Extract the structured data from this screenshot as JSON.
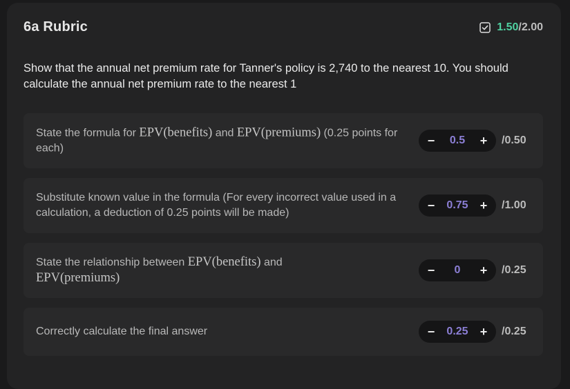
{
  "header": {
    "title": "6a Rubric",
    "score_earned": "1.50",
    "score_sep": "/",
    "score_total": "2.00",
    "icon": "checkbox-checked-icon",
    "accent_color": "#4fd1a1"
  },
  "question": "Show that the annual net premium rate for Tanner's policy is 2,740 to the nearest 10. You should calculate the annual net premium rate to the nearest 1",
  "criteria": [
    {
      "pre": "State the formula for ",
      "math1": "EPV(benefits)",
      "mid": " and ",
      "math2": "EPV(premiums)",
      "post": " (0.25 points for each)",
      "value": "0.5",
      "max": "/0.50"
    },
    {
      "text": "Substitute known value in the formula (For every incorrect value used in a calculation, a deduction of 0.25 points will be made)",
      "value": "0.75",
      "max": "/1.00"
    },
    {
      "pre": "State the relationship between ",
      "math1": "EPV(benefits)",
      "mid": " and",
      "math2": "EPV(premiums)",
      "value": "0",
      "max": "/0.25"
    },
    {
      "text": "Correctly calculate the final answer",
      "value": "0.25",
      "max": "/0.25"
    }
  ],
  "stepper": {
    "minus_label": "−",
    "plus_label": "+",
    "value_color": "#8c7fd6"
  }
}
